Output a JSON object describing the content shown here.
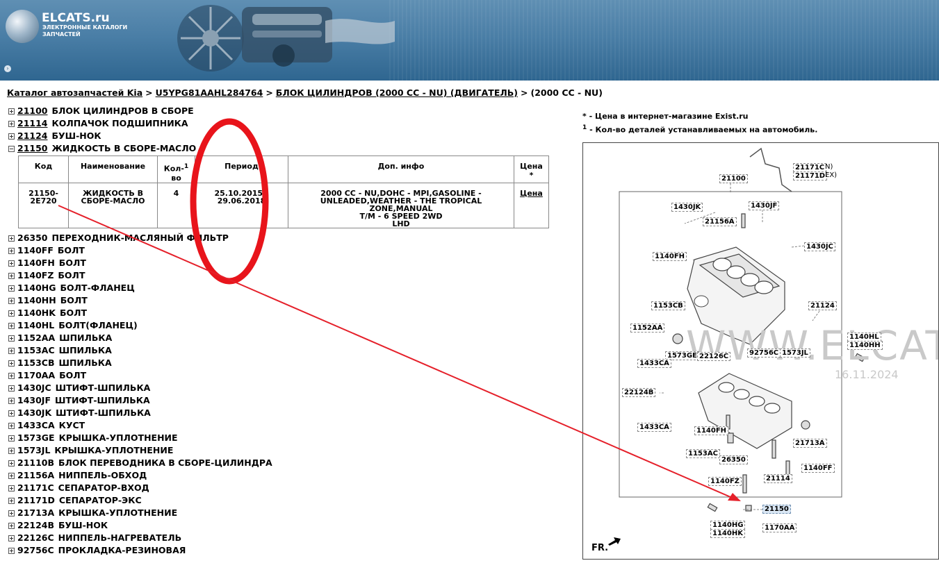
{
  "header": {
    "logo_title": "ELCATS.ru",
    "logo_subtitle": "ЭЛЕКТРОННЫЕ КАТАЛОГИ ЗАПЧАСТЕЙ",
    "nav_icon": "arrow-right-icon"
  },
  "breadcrumb": {
    "items": [
      "Каталог автозапчастей Kia",
      "U5YPG81AAHL284764",
      "БЛОК ЦИЛИНДРОВ (2000 CC - NU) (ДВИГАТЕЛЬ)"
    ],
    "current": "(2000 CC - NU)",
    "separator": ">"
  },
  "tree_top": [
    {
      "code": "21100",
      "name": "БЛОК ЦИЛИНДРОВ В СБОРЕ"
    },
    {
      "code": "21114",
      "name": "КОЛПАЧОК ПОДШИПНИКА"
    },
    {
      "code": "21124",
      "name": "БУШ-НОК"
    },
    {
      "code": "21150",
      "name": "ЖИДКОСТЬ В СБОРЕ-МАСЛО",
      "expanded": true
    }
  ],
  "table": {
    "headers": {
      "code": "Код",
      "name": "Наименование",
      "qty_line1": "Кол-",
      "qty_line2": "во",
      "qty_sup": "1",
      "period": "Период",
      "info": "Доп. инфо",
      "price": "Цена",
      "price_sup": "*"
    },
    "row": {
      "code_line1": "21150-",
      "code_line2": "2E720",
      "name_line1": "ЖИДКОСТЬ В",
      "name_line2": "СБОРЕ-МАСЛО",
      "qty": "4",
      "period_line1": "25.10.2015 -",
      "period_line2": "29.06.2018",
      "info_line1": "2000 CC - NU,DOHC - MPI,GASOLINE -",
      "info_line2": "UNLEADED,WEATHER - THE TROPICAL ZONE,MANUAL",
      "info_line3": "T/M - 6 SPEED 2WD",
      "info_line4": "LHD",
      "price_link": "Цена"
    }
  },
  "tree_bottom": [
    {
      "code": "26350",
      "name": "ПЕРЕХОДНИК-МАСЛЯНЫЙ ФИЛЬТР"
    },
    {
      "code": "1140FF",
      "name": "БОЛТ"
    },
    {
      "code": "1140FH",
      "name": "БОЛТ"
    },
    {
      "code": "1140FZ",
      "name": "БОЛТ"
    },
    {
      "code": "1140HG",
      "name": "БОЛТ-ФЛАНЕЦ"
    },
    {
      "code": "1140HH",
      "name": "БОЛТ"
    },
    {
      "code": "1140HK",
      "name": "БОЛТ"
    },
    {
      "code": "1140HL",
      "name": "БОЛТ(ФЛАНЕЦ)"
    },
    {
      "code": "1152AA",
      "name": "ШПИЛЬКА"
    },
    {
      "code": "1153AC",
      "name": "ШПИЛЬКА"
    },
    {
      "code": "1153CB",
      "name": "ШПИЛЬКА"
    },
    {
      "code": "1170AA",
      "name": "БОЛТ"
    },
    {
      "code": "1430JC",
      "name": "ШТИФТ-ШПИЛЬКА"
    },
    {
      "code": "1430JF",
      "name": "ШТИФТ-ШПИЛЬКА"
    },
    {
      "code": "1430JK",
      "name": "ШТИФТ-ШПИЛЬКА"
    },
    {
      "code": "1433CA",
      "name": "КУСТ"
    },
    {
      "code": "1573GE",
      "name": "КРЫШКА-УПЛОТНЕНИЕ"
    },
    {
      "code": "1573JL",
      "name": "КРЫШКА-УПЛОТНЕНИЕ"
    },
    {
      "code": "21110B",
      "name": "БЛОК ПЕРЕВОДНИКА В СБОРЕ-ЦИЛИНДРА"
    },
    {
      "code": "21156A",
      "name": "НИППЕЛЬ-ОБХОД"
    },
    {
      "code": "21171C",
      "name": "СЕПАРАТОР-ВХОД"
    },
    {
      "code": "21171D",
      "name": "СЕПАРАТОР-ЭКС"
    },
    {
      "code": "21713A",
      "name": "КРЫШКА-УПЛОТНЕНИЕ"
    },
    {
      "code": "22124B",
      "name": "БУШ-НОК"
    },
    {
      "code": "22126C",
      "name": "НИППЕЛЬ-НАГРЕВАТЕЛЬ"
    },
    {
      "code": "92756C",
      "name": "ПРОКЛАДКА-РЕЗИНОВАЯ"
    }
  ],
  "legend": {
    "price_mark": "*",
    "price_text": " - Цена в интернет-магазине Exist.ru",
    "qty_mark": "1",
    "qty_text": " - Кол-во деталей устанавливаемых на автомобиль."
  },
  "diagram": {
    "watermark": "WWW.ELCATS",
    "watermark_date": "16.11.2024",
    "front_label": "FR.",
    "callouts": {
      "c21171C": "21171C",
      "c21171C_suffix": "N)",
      "c21171D": "21171D",
      "c21171D_suffix": "EX)",
      "c21100": "21100",
      "c1430JK": "1430JK",
      "c1430JF": "1430JF",
      "c21156A": "21156A",
      "c1430JC": "1430JC",
      "c1140FH": "1140FH",
      "c1153CB": "1153CB",
      "c21124": "21124",
      "c1152AA": "1152AA",
      "c1140HL": "1140HL",
      "c1140HH": "1140HH",
      "c1573GE": "1573GE",
      "c22126C": "22126C",
      "c92756C": "92756C",
      "c1573JL": "1573JL",
      "c1433CA_1": "1433CA",
      "c22124B": "22124B",
      "c1433CA_2": "1433CA",
      "c1140FH_2": "1140FH",
      "c21713A": "21713A",
      "c1153AC": "1153AC",
      "c26350": "26350",
      "c1140FF": "1140FF",
      "c21114": "21114",
      "c1140FZ": "1140FZ",
      "c21150": "21150",
      "c1140HG": "1140HG",
      "c1140HK": "1140HK",
      "c1170AA": "1170AA"
    }
  },
  "annotation": {
    "ellipse_color": "#e8141b",
    "arrow_color": "#e5202a"
  }
}
